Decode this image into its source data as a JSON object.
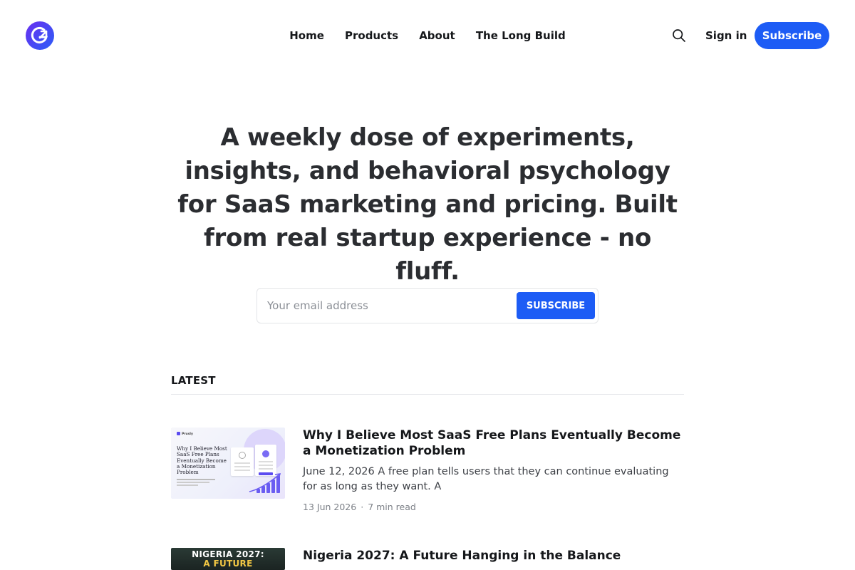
{
  "header": {
    "nav": [
      "Home",
      "Products",
      "About",
      "The Long Build"
    ],
    "signin_label": "Sign in",
    "subscribe_label": "Subscribe",
    "accent_color": "#1d5cf5"
  },
  "hero": {
    "heading": "A weekly dose of experiments, insights, and behavioral psychology for SaaS marketing and pricing. Built from real startup experience - no fluff.",
    "email_placeholder": "Your email address",
    "subscribe_button": "SUBSCRIBE"
  },
  "latest": {
    "title": "LATEST",
    "posts": [
      {
        "title": "Why I Believe Most SaaS Free Plans Eventually Become a Monetization Problem",
        "excerpt": "June 12, 2026 A free plan tells users that they can continue evaluating for as long as they want. A",
        "date": "13 Jun 2026",
        "read_time": "7 min read",
        "thumb": {
          "brand": "Prusly",
          "title": "Why I Believe Most SaaS Free Plans Eventually Become a Monetization Problem"
        }
      },
      {
        "title": "Nigeria 2027: A Future Hanging in the Balance",
        "thumb": {
          "line1": "NIGERIA 2027:",
          "line2": "A FUTURE"
        }
      }
    ]
  }
}
